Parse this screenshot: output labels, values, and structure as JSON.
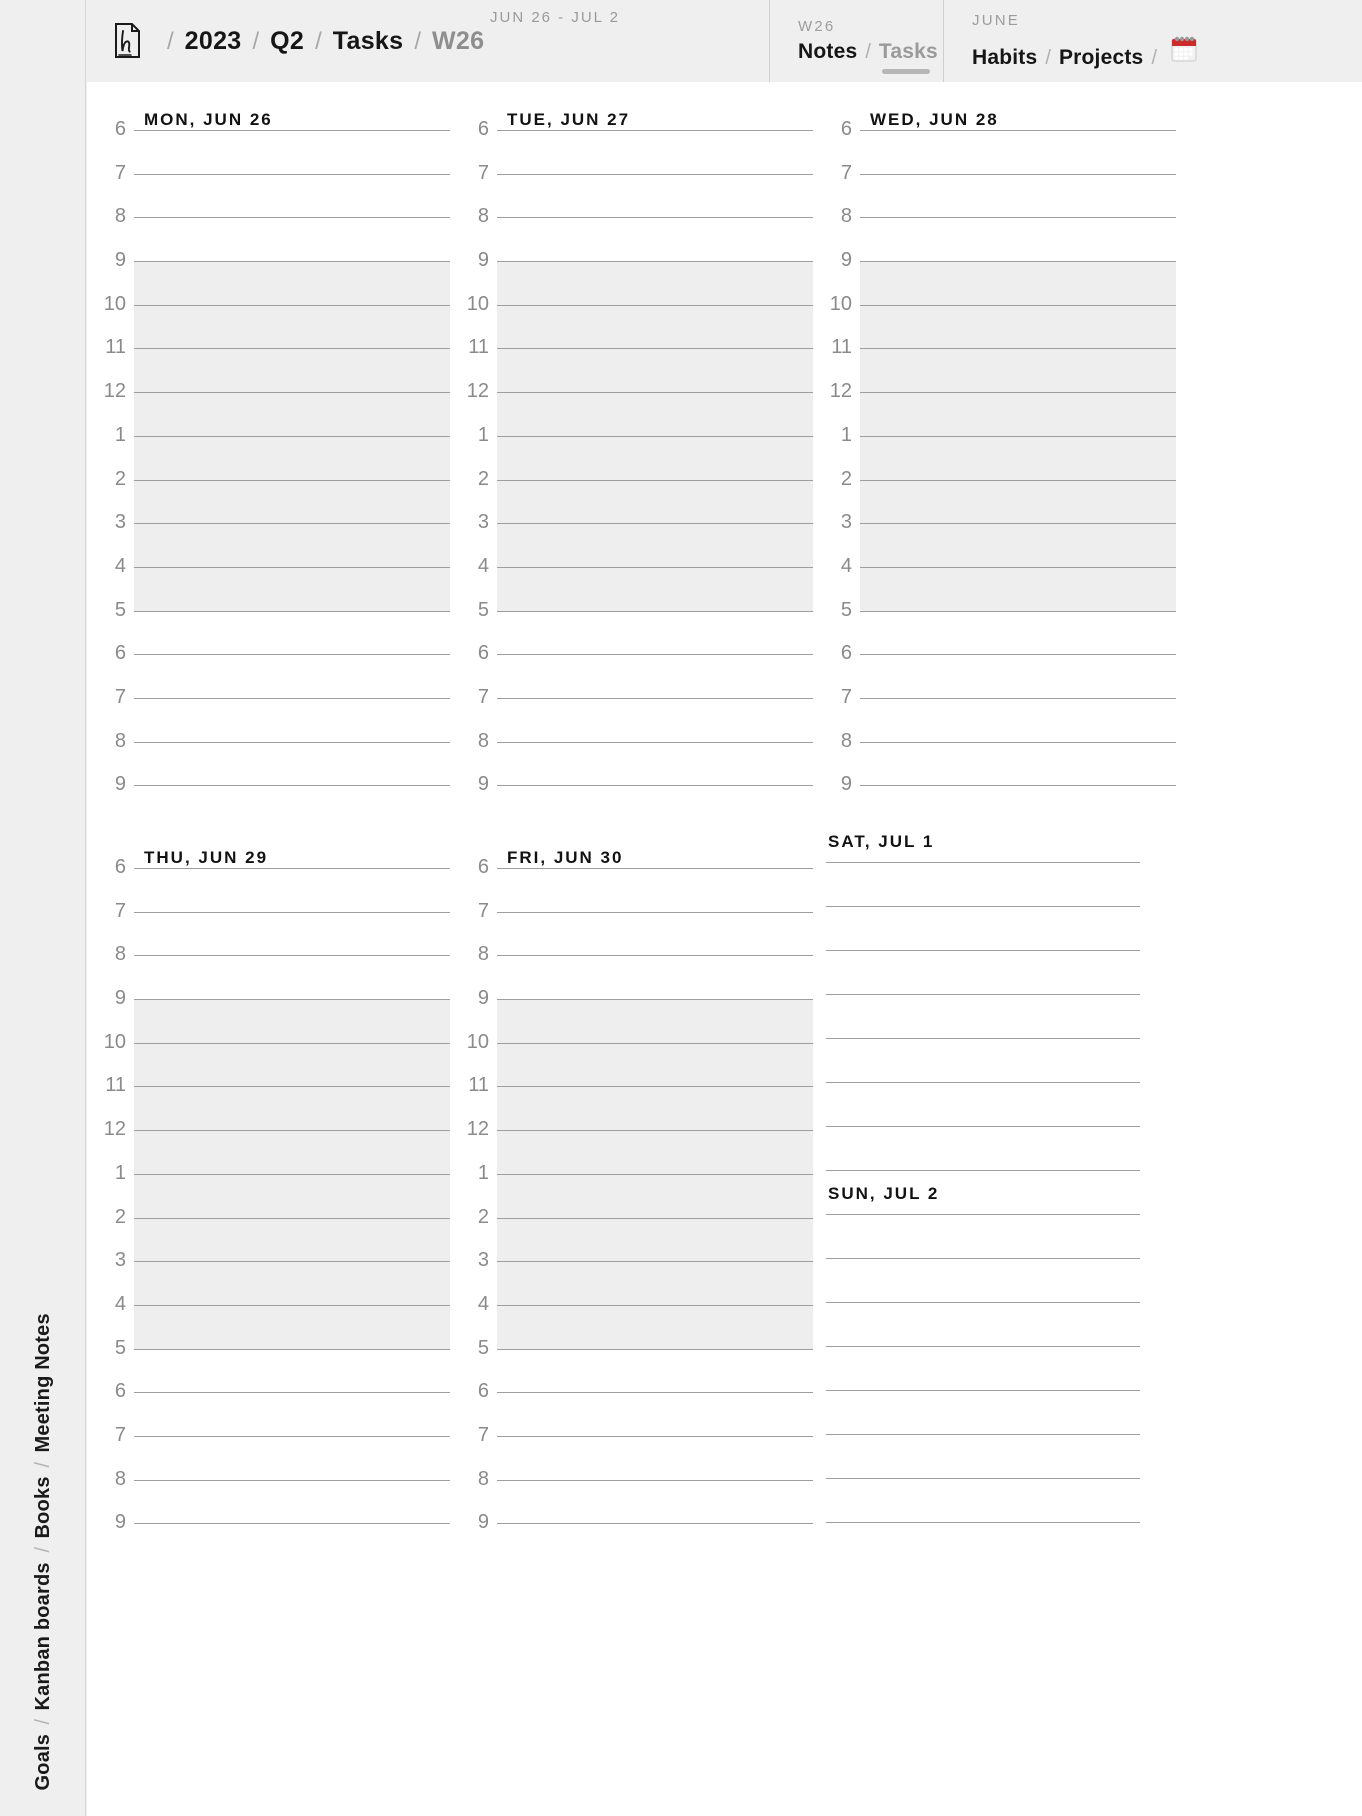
{
  "app": {
    "logo_icon": "handwritten-page-icon",
    "background_color": "#efefef",
    "page_color": "#ffffff",
    "line_color": "#9e9e9e",
    "shade_color": "#eeeeee",
    "muted_text_color": "#8a8a8a"
  },
  "breadcrumb": {
    "items": [
      {
        "label": "2023",
        "active": true
      },
      {
        "label": "Q2",
        "active": true
      },
      {
        "label": "Tasks",
        "active": true
      },
      {
        "label": "W26",
        "active": false
      }
    ],
    "separator": "/",
    "date_range": "JUN 26 - JUL 2"
  },
  "panels": [
    {
      "kicker": "W26",
      "links": [
        {
          "label": "Notes",
          "selected": true
        },
        {
          "label": "Tasks",
          "selected": false
        }
      ],
      "separator": "/"
    },
    {
      "kicker": "JUNE",
      "links": [
        {
          "label": "Habits",
          "selected": true
        },
        {
          "label": "Projects",
          "selected": true
        }
      ],
      "separator": "/",
      "icon": "calendar-icon"
    }
  ],
  "sidebar": {
    "items": [
      "Goals",
      "Kanban boards",
      "Books",
      "Meeting Notes"
    ],
    "separator": "/"
  },
  "calendar": {
    "hours": [
      "6",
      "7",
      "8",
      "9",
      "10",
      "11",
      "12",
      "1",
      "2",
      "3",
      "4",
      "5",
      "6",
      "7",
      "8",
      "9"
    ],
    "shade_start_hour": "9",
    "shade_end_hour": "5",
    "days": [
      {
        "title": "MON, JUN 26",
        "kind": "timed",
        "row": 1,
        "col": 1
      },
      {
        "title": "TUE, JUN 27",
        "kind": "timed",
        "row": 1,
        "col": 2
      },
      {
        "title": "WED, JUN 28",
        "kind": "timed",
        "row": 1,
        "col": 3
      },
      {
        "title": "THU, JUN 29",
        "kind": "timed",
        "row": 2,
        "col": 1
      },
      {
        "title": "FRI, JUN 30",
        "kind": "timed",
        "row": 2,
        "col": 2
      },
      {
        "title": "SAT, JUL 1",
        "kind": "ruled",
        "row": 2,
        "col": 3,
        "lines": 9
      },
      {
        "title": "SUN, JUL 2",
        "kind": "ruled",
        "row": 2,
        "col": 3,
        "lines": 8
      }
    ]
  }
}
